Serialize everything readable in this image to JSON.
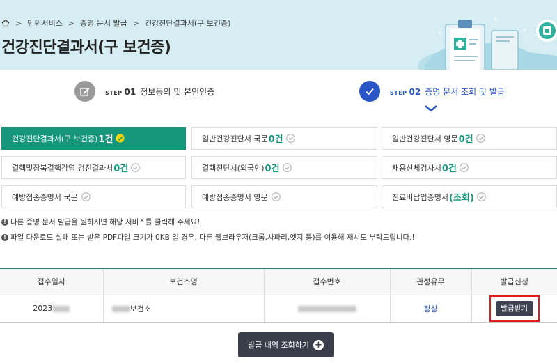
{
  "breadcrumb": {
    "items": [
      "민원서비스",
      "증명 문서 발급",
      "건강진단결과서(구 보건증)"
    ]
  },
  "page": {
    "title": "건강진단결과서(구 보건증)"
  },
  "steps": [
    {
      "word": "STEP",
      "num": "01",
      "label": "정보동의 및 본인인증",
      "state": "done"
    },
    {
      "word": "STEP",
      "num": "02",
      "label": "증명 문서 조회 및 발급",
      "state": "current"
    }
  ],
  "documents": [
    {
      "label": "건강진단결과서(구 보건증)",
      "count": "1건",
      "active": true
    },
    {
      "label": "일반건강진단서 국문",
      "count": "0건",
      "active": false
    },
    {
      "label": "일반건강진단서 영문",
      "count": "0건",
      "active": false
    },
    {
      "label": "결핵및잠복결핵감염 검진결과서",
      "count": "0건",
      "active": false
    },
    {
      "label": "결핵진단서(외국인)",
      "count": "0건",
      "active": false
    },
    {
      "label": "채용신체검사서",
      "count": "0건",
      "active": false
    },
    {
      "label": "예방접종증명서 국문",
      "count": "",
      "active": false
    },
    {
      "label": "예방접종증명서 영문",
      "count": "",
      "active": false
    },
    {
      "label": "진료비납입증명서",
      "count": "(조회)",
      "active": false
    }
  ],
  "notices": [
    "다른 증명 문서 발급을 원하시면 해당 서비스를 클릭해 주세요!",
    "파일 다운로드 실패 또는 받은 PDF파일 크기가 0KB 일 경우, 다른 웹브라우저(크롬,사파리,엣지 등)를 이용해 재시도 부탁드립니다.!"
  ],
  "table": {
    "headers": [
      "접수일자",
      "보건소명",
      "접수번호",
      "판정유무",
      "발급신청"
    ],
    "rows": [
      {
        "date": "2023",
        "center": "보건소",
        "receipt": "",
        "status": "정상",
        "action": "발급받기"
      }
    ]
  },
  "view_button": {
    "label": "발급 내역 조회하기"
  },
  "colors": {
    "header_bg": "#d6eef3",
    "active_doc": "#15967b",
    "step_active": "#2a56c6",
    "button_dark": "#3e4250",
    "highlight_border": "#e21b1b"
  }
}
